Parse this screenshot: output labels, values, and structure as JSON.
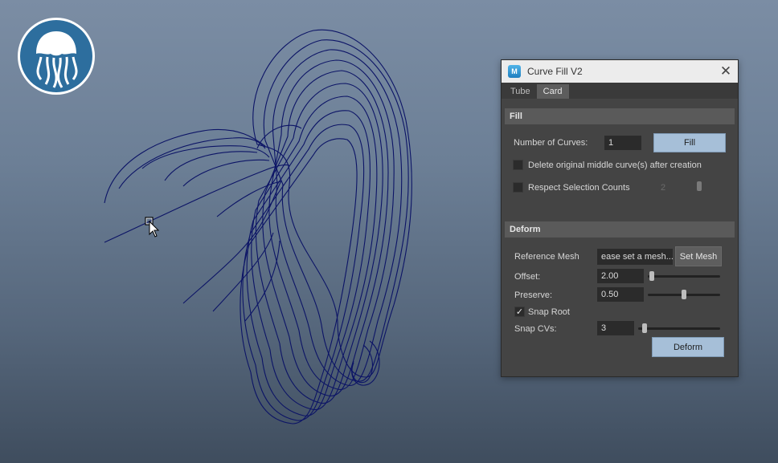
{
  "window": {
    "title": "Curve Fill V2",
    "app_icon_letter": "M",
    "close_icon": "close-icon"
  },
  "tabs": [
    {
      "label": "Tube",
      "active": false
    },
    {
      "label": "Card",
      "active": true
    }
  ],
  "fill": {
    "header": "Fill",
    "num_curves_label": "Number of Curves:",
    "num_curves_value": "1",
    "fill_button": "Fill",
    "delete_label": "Delete original middle curve(s) after creation",
    "delete_checked": false,
    "respect_label": "Respect Selection Counts",
    "respect_checked": false,
    "respect_value": "2"
  },
  "deform": {
    "header": "Deform",
    "ref_mesh_label": "Reference Mesh",
    "ref_mesh_value": "ease set a mesh...",
    "set_mesh_button": "Set Mesh",
    "offset_label": "Offset:",
    "offset_value": "2.00",
    "offset_slider_fraction": 0.02,
    "preserve_label": "Preserve:",
    "preserve_value": "0.50",
    "preserve_slider_fraction": 0.5,
    "snap_root_label": "Snap Root",
    "snap_root_checked": true,
    "snap_cvs_label": "Snap CVs:",
    "snap_cvs_value": "3",
    "snap_cvs_slider_fraction": 0.05,
    "deform_button": "Deform"
  },
  "colors": {
    "curve": "#0c1466",
    "button_blue": "#a6bfd8",
    "logo_bg": "#2d6e9e"
  }
}
